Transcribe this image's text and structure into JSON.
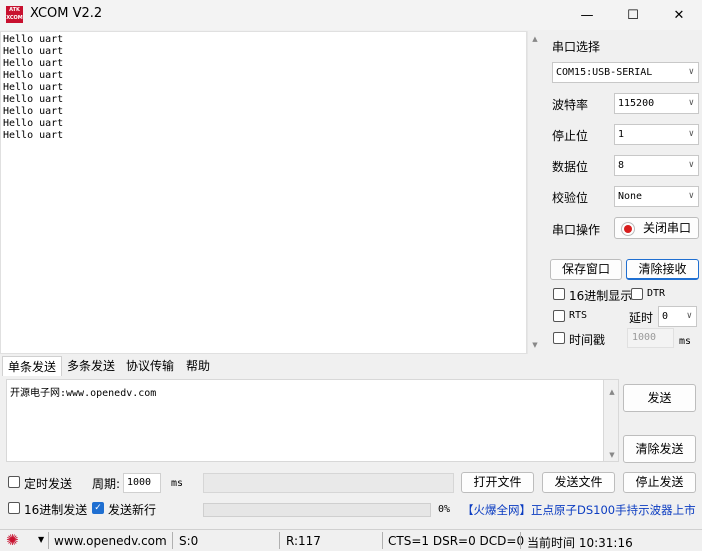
{
  "window": {
    "title": "XCOM V2.2",
    "logo_top": "ATK",
    "logo_bottom": "XCOM",
    "minimize": "—",
    "maximize": "☐",
    "close": "✕"
  },
  "receive": {
    "lines": [
      "Hello uart",
      "Hello uart",
      "Hello uart",
      "Hello uart",
      "Hello uart",
      "Hello uart",
      "Hello uart",
      "Hello uart",
      "Hello uart"
    ]
  },
  "settings": {
    "port_label": "串口选择",
    "port_value": "COM15:USB-SERIAL",
    "baud_label": "波特率",
    "baud_value": "115200",
    "stop_label": "停止位",
    "stop_value": "1",
    "data_label": "数据位",
    "data_value": "8",
    "parity_label": "校验位",
    "parity_value": "None",
    "op_label": "串口操作",
    "close_port": "关闭串口",
    "save_window": "保存窗口",
    "clear_receive": "清除接收",
    "hex_display": "16进制显示",
    "dtr": "DTR",
    "rts": "RTS",
    "delay_label": "延时",
    "delay_value": "0",
    "timestamp": "时间戳",
    "timestamp_value": "1000",
    "timestamp_unit": "ms"
  },
  "tabs": [
    "单条发送",
    "多条发送",
    "协议传输",
    "帮助"
  ],
  "send": {
    "text": "开源电子网:www.openedv.com",
    "send_button": "发送",
    "clear_send_button": "清除发送",
    "timed_send": "定时发送",
    "period_label": "周期:",
    "period_value": "1000",
    "period_unit": "ms",
    "open_file": "打开文件",
    "send_file": "发送文件",
    "stop_send": "停止发送",
    "hex_send": "16进制发送",
    "send_newline": "发送新行",
    "progress_text": "0%",
    "progress": 0,
    "ad_link": "【火爆全网】正点原子DS100手持示波器上市"
  },
  "statusbar": {
    "url": "www.openedv.com",
    "sent": "S:0",
    "received": "R:117",
    "signals": "CTS=1 DSR=0 DCD=0",
    "time_label": "当前时间 10:31:16"
  },
  "colors": {
    "accent": "#1f6fd1",
    "record_red": "#d81e1e",
    "link_blue": "#0b3cc1",
    "gear_red": "#c8102e"
  }
}
